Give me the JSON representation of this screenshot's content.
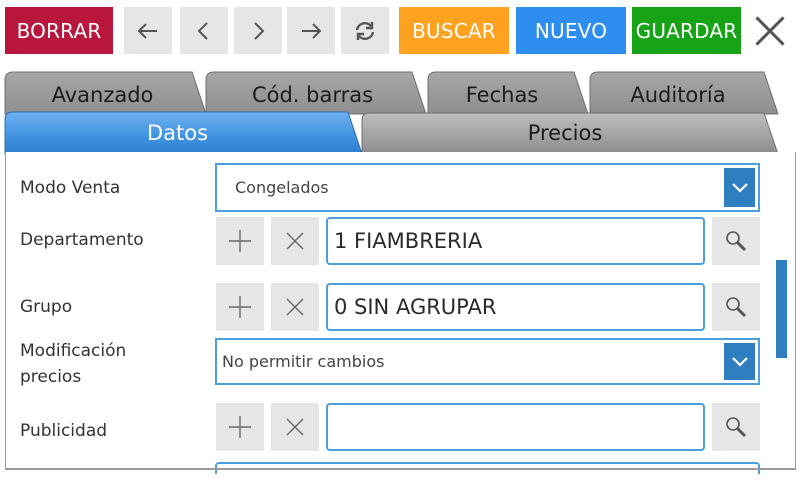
{
  "toolbar": {
    "delete_label": "BORRAR",
    "search_label": "BUSCAR",
    "new_label": "NUEVO",
    "save_label": "GUARDAR",
    "delete_color": "#b8163c",
    "search_color": "#ffa21f",
    "new_color": "#2d8ef0",
    "save_color": "#16a316"
  },
  "tabs": {
    "back_row": [
      "Avanzado",
      "Cód. barras",
      "Fechas",
      "Auditoría"
    ],
    "front_row": [
      "Datos",
      "Precios"
    ],
    "active": "Datos"
  },
  "form": {
    "modo_venta": {
      "label": "Modo Venta",
      "value": "Congelados"
    },
    "departamento": {
      "label": "Departamento",
      "value": "1 FIAMBRERIA"
    },
    "grupo": {
      "label": "Grupo",
      "value": "0 SIN AGRUPAR"
    },
    "modificacion_precios": {
      "label_line1": "Modificación",
      "label_line2": "precios",
      "value": "No permitir cambios"
    },
    "publicidad": {
      "label": "Publicidad",
      "value": ""
    }
  },
  "icons": [
    "arrow-left-icon",
    "chevron-left-icon",
    "chevron-right-icon",
    "arrow-right-icon",
    "refresh-icon",
    "close-icon",
    "plus-icon",
    "x-icon",
    "magnifier-icon",
    "chevron-down-icon"
  ]
}
